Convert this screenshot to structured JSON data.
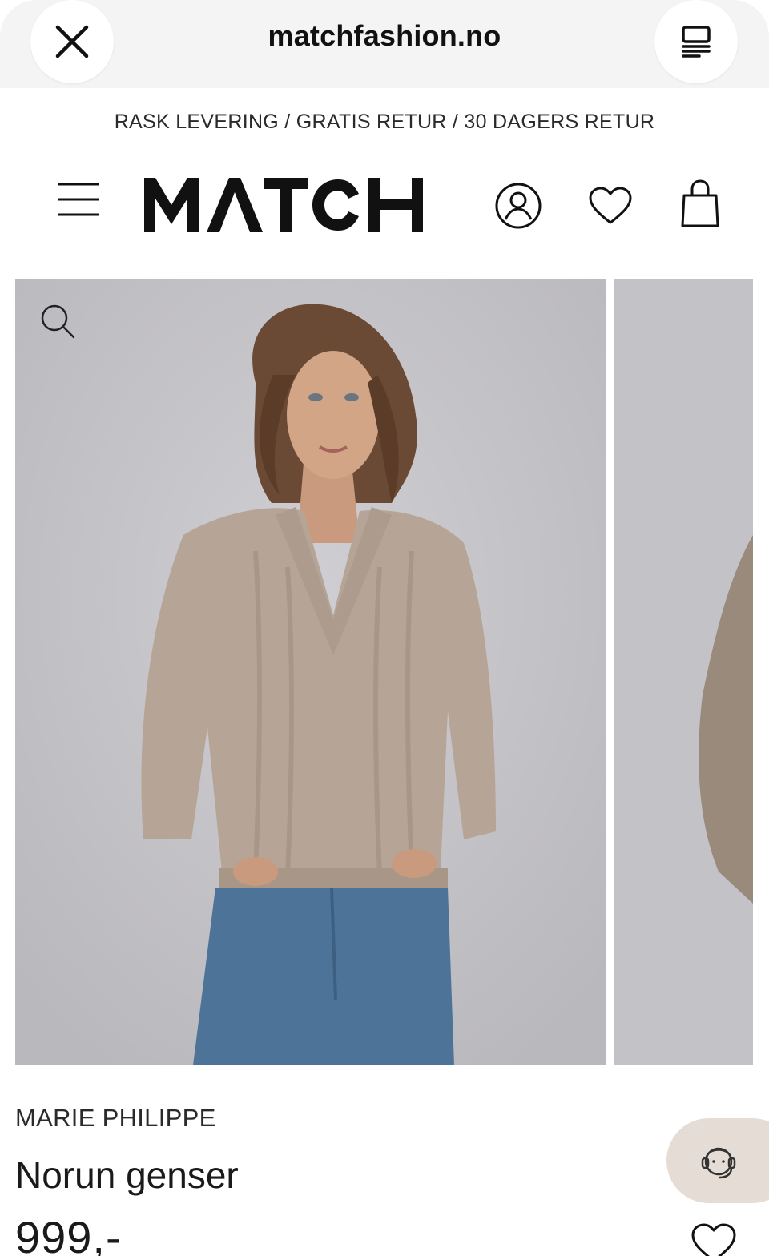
{
  "browser": {
    "url": "matchfashion.no",
    "close_icon": "close-icon",
    "tabs_icon": "tab-overview-icon"
  },
  "promo_bar": {
    "text": "RASK LEVERING / GRATIS RETUR / 30 DAGERS RETUR"
  },
  "header": {
    "logo_text": "MATCH",
    "icons": [
      "menu-icon",
      "account-icon",
      "heart-icon",
      "bag-icon"
    ]
  },
  "gallery": {
    "zoom_icon": "search-icon",
    "main_image": "model-in-beige-knit-sweater",
    "next_image": "sweater-side-view"
  },
  "product": {
    "brand": "MARIE PHILIPPE",
    "name": "Norun genser",
    "price": "999,-"
  },
  "support": {
    "icon": "customer-service-icon"
  },
  "colors": {
    "sweater": "#b6a596",
    "jeans": "#4d7399",
    "background_grey": "#c6c5c9",
    "chat_bubble": "#e5ddd5"
  }
}
